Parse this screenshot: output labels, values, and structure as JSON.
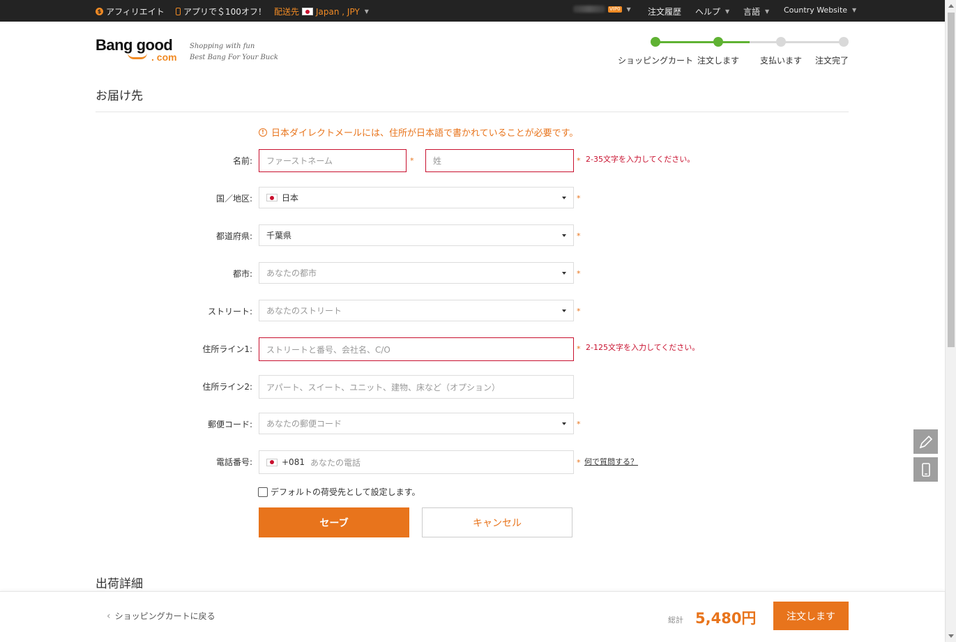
{
  "topbar": {
    "affiliate": "アフィリエイト",
    "app_promo": "アプリで＄100オフ！",
    "ship_to_label": "配送先",
    "ship_to_value": "Japan , JPY",
    "vip_badge": "VIP0",
    "order_history": "注文履歴",
    "help": "ヘルプ",
    "language": "言語",
    "country_website": "Country Website"
  },
  "logo": {
    "brand": "Bang good",
    "domain": ". com",
    "tagline1": "Shopping with fun",
    "tagline2": "Best Bang For Your Buck"
  },
  "progress": {
    "steps": [
      "ショッピングカート",
      "注文します",
      "支払います",
      "注文完了"
    ],
    "completed_steps": 2,
    "active_color": "#5fb233",
    "inactive_color": "#d9d9d9"
  },
  "address_section": {
    "title": "お届け先",
    "notice": "日本ダイレクトメールには、住所が日本語で書かれていることが必要です。"
  },
  "form": {
    "name": {
      "label": "名前:",
      "first_placeholder": "ファーストネーム",
      "last_placeholder": "姓",
      "error": "2-35文字を入力してください。"
    },
    "country": {
      "label": "国／地区:",
      "value": "日本"
    },
    "prefecture": {
      "label": "都道府県:",
      "value": "千葉県"
    },
    "city": {
      "label": "都市:",
      "placeholder": "あなたの都市"
    },
    "street": {
      "label": "ストリート:",
      "placeholder": "あなたのストリート"
    },
    "address1": {
      "label": "住所ライン1:",
      "placeholder": "ストリートと番号、会社名、C/O",
      "error": "2-125文字を入力してください。"
    },
    "address2": {
      "label": "住所ライン2:",
      "placeholder": "アパート、スイート、ユニット、建物、床など（オプション）"
    },
    "postal": {
      "label": "郵便コード:",
      "placeholder": "あなたの郵便コード"
    },
    "phone": {
      "label": "電話番号:",
      "code": "+081",
      "placeholder": "あなたの電話",
      "help": "何で質問する？"
    },
    "required_mark": "*",
    "default_checkbox": "デフォルトの荷受先として設定します。",
    "save": "セーブ",
    "cancel": "キャンセル"
  },
  "shipping_section": {
    "title": "出荷詳細"
  },
  "footer": {
    "back": "ショッピングカートに戻る",
    "total_label": "総計",
    "total_amount": "5,480円",
    "place_order": "注文します"
  },
  "colors": {
    "accent": "#e8741c",
    "error": "#c8102e",
    "topbar": "#232323"
  }
}
